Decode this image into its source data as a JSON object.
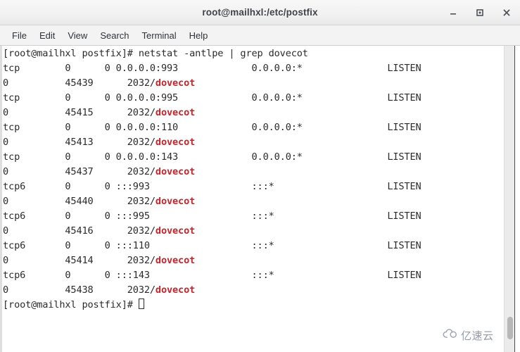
{
  "window": {
    "title": "root@mailhxl:/etc/postfix",
    "controls": [
      {
        "name": "minimize-button",
        "glyph": "minimize"
      },
      {
        "name": "maximize-button",
        "glyph": "maximize"
      },
      {
        "name": "close-button",
        "glyph": "close"
      }
    ]
  },
  "menubar": {
    "items": [
      {
        "label": "File"
      },
      {
        "label": "Edit"
      },
      {
        "label": "View"
      },
      {
        "label": "Search"
      },
      {
        "label": "Terminal"
      },
      {
        "label": "Help"
      }
    ]
  },
  "terminal": {
    "prompt": "[root@mailhxl postfix]# ",
    "command": "netstat -antlpe | grep dovecot",
    "final_prompt": "[root@mailhxl postfix]# ",
    "cursor": "block-hollow",
    "highlight_color": "#cc2229",
    "foreground_color": "#2b2b2b",
    "background_color": "#ffffff",
    "lines": [
      {
        "pre": "tcp        0      0 0.0.0.0:993             0.0.0.0:*               LISTEN"
      },
      {
        "pre": "0          45439      2032/",
        "highlight": "dovecot"
      },
      {
        "pre": "tcp        0      0 0.0.0.0:995             0.0.0.0:*               LISTEN"
      },
      {
        "pre": "0          45415      2032/",
        "highlight": "dovecot"
      },
      {
        "pre": "tcp        0      0 0.0.0.0:110             0.0.0.0:*               LISTEN"
      },
      {
        "pre": "0          45413      2032/",
        "highlight": "dovecot"
      },
      {
        "pre": "tcp        0      0 0.0.0.0:143             0.0.0.0:*               LISTEN"
      },
      {
        "pre": "0          45437      2032/",
        "highlight": "dovecot"
      },
      {
        "pre": "tcp6       0      0 :::993                  :::*                    LISTEN"
      },
      {
        "pre": "0          45440      2032/",
        "highlight": "dovecot"
      },
      {
        "pre": "tcp6       0      0 :::995                  :::*                    LISTEN"
      },
      {
        "pre": "0          45416      2032/",
        "highlight": "dovecot"
      },
      {
        "pre": "tcp6       0      0 :::110                  :::*                    LISTEN"
      },
      {
        "pre": "0          45414      2032/",
        "highlight": "dovecot"
      },
      {
        "pre": "tcp6       0      0 :::143                  :::*                    LISTEN"
      },
      {
        "pre": "0          45438      2032/",
        "highlight": "dovecot"
      }
    ]
  },
  "watermark": {
    "text": "亿速云",
    "icon": "cloud-icon"
  }
}
